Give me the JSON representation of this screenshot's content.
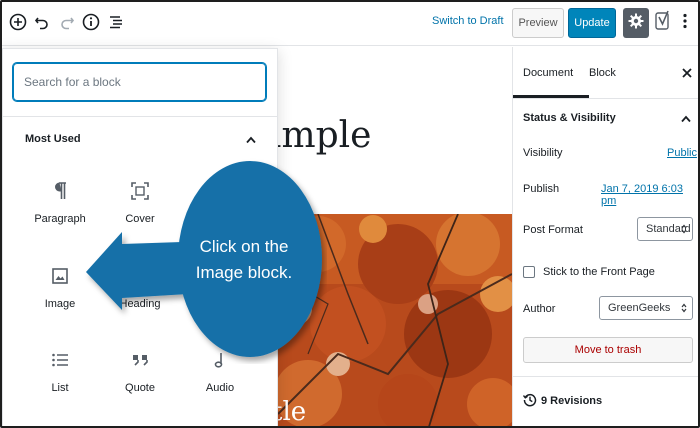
{
  "toolbar": {
    "switch_to_draft": "Switch to Draft",
    "preview": "Preview",
    "update": "Update",
    "icons": [
      "add-block-icon",
      "undo-icon",
      "redo-icon",
      "info-icon",
      "outline-icon",
      "gear-icon",
      "yoast-icon",
      "more-menu-icon"
    ]
  },
  "editor": {
    "title_fragment": "ample",
    "image_caption_fragment": "tle"
  },
  "inserter": {
    "search_placeholder": "Search for a block",
    "panel_title": "Most Used",
    "blocks": [
      {
        "label": "Paragraph",
        "icon": "paragraph-icon"
      },
      {
        "label": "Cover",
        "icon": "cover-icon"
      },
      {
        "label": "Image",
        "icon": "image-icon"
      },
      {
        "label": "Heading",
        "icon": "heading-icon"
      },
      {
        "label": "List",
        "icon": "list-icon"
      },
      {
        "label": "Quote",
        "icon": "quote-icon"
      },
      {
        "label": "Audio",
        "icon": "audio-icon"
      }
    ]
  },
  "callout": {
    "line1": "Click on the",
    "line2": "Image block.",
    "color": "#1670a8"
  },
  "sidebar": {
    "tabs": [
      "Document",
      "Block"
    ],
    "section_title": "Status & Visibility",
    "visibility_label": "Visibility",
    "visibility_value": "Public",
    "publish_label": "Publish",
    "publish_value": "Jan 7, 2019 6:03 pm",
    "post_format_label": "Post Format",
    "post_format_value": "Standard",
    "sticky_label": "Stick to the Front Page",
    "author_label": "Author",
    "author_value": "GreenGeeks",
    "trash_label": "Move to trash",
    "revisions_label": "9 Revisions"
  },
  "colors": {
    "accent": "#0085ba",
    "link": "#0073aa",
    "trash": "#a00000",
    "autumn_orange": "#c4521d"
  }
}
